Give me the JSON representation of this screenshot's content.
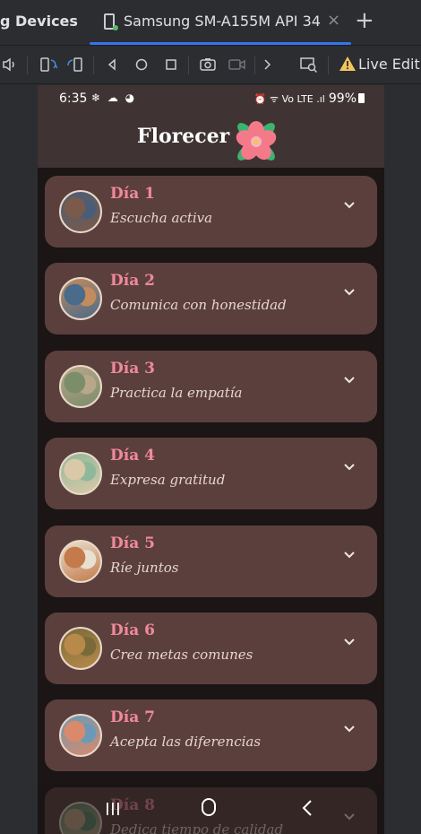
{
  "ide": {
    "tab_left_label": "g Devices",
    "active_tab_label": "Samsung SM-A155M API 34",
    "close_glyph": "×",
    "add_glyph": "+",
    "live_edit_label": "Live Edit",
    "toolbar_icons": [
      "volume-icon",
      "rotate-left-icon",
      "rotate-right-icon",
      "back-icon",
      "home-icon",
      "overview-icon",
      "screenshot-icon",
      "record-icon",
      "more-icon",
      "inspect-icon",
      "warning-icon"
    ]
  },
  "status_bar": {
    "time": "6:35",
    "left_icons": "❄ ☁ ◕",
    "right_icons": "⏰ ᯤ Vo LTE .ıl",
    "battery": "99%"
  },
  "app": {
    "title": "Florecer",
    "logo_icon": "flower-icon",
    "accent_color": "#f08a9a",
    "card_color": "#5b3f3d"
  },
  "days": [
    {
      "day": "Día 1",
      "title": "Escucha activa",
      "avatar_colors": [
        "#4a5d78",
        "#7a5a4a"
      ]
    },
    {
      "day": "Día 2",
      "title": "Comunica con honestidad",
      "avatar_colors": [
        "#c48b5c",
        "#4a6b8a"
      ]
    },
    {
      "day": "Día 3",
      "title": "Practica la empatía",
      "avatar_colors": [
        "#b8a78a",
        "#7c8d6a"
      ]
    },
    {
      "day": "Día 4",
      "title": "Expresa gratitud",
      "avatar_colors": [
        "#8fb89a",
        "#d9c9a8"
      ]
    },
    {
      "day": "Día 5",
      "title": "Ríe juntos",
      "avatar_colors": [
        "#e8e0d0",
        "#c47a4a"
      ]
    },
    {
      "day": "Día 6",
      "title": "Crea metas comunes",
      "avatar_colors": [
        "#7a6a3a",
        "#b88a4a"
      ]
    },
    {
      "day": "Día 7",
      "title": "Acepta las diferencias",
      "avatar_colors": [
        "#6a9ab8",
        "#d88a6a"
      ]
    },
    {
      "day": "Día 8",
      "title": "Dedica tiempo de calidad",
      "avatar_colors": [
        "#5a8a6a",
        "#c8a88a"
      ]
    }
  ]
}
